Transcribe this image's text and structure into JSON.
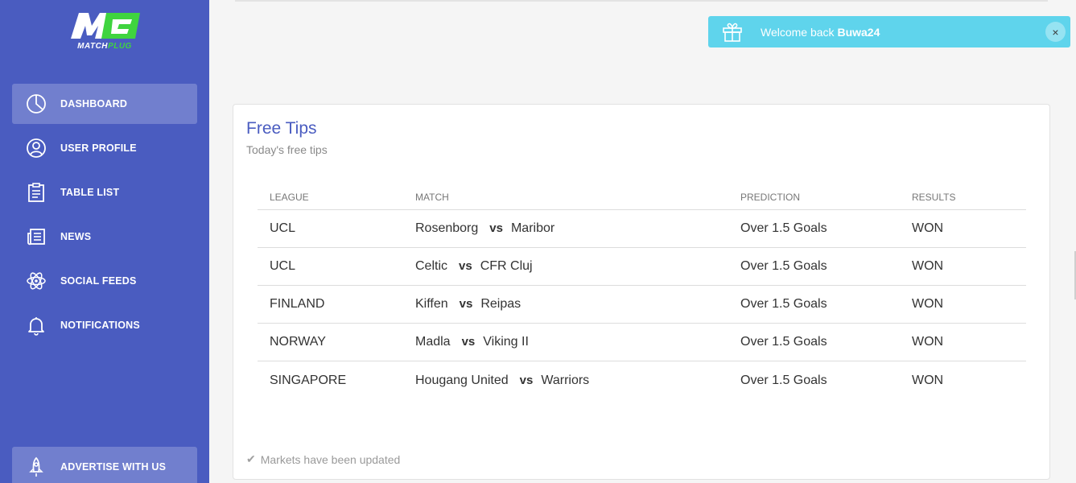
{
  "brand": {
    "logo_top": "M",
    "logo_match": "MATCH",
    "logo_plug": "PLUG",
    "accent": "#4a5cc0",
    "green": "#3fd43f"
  },
  "sidebar": {
    "items": [
      {
        "label": "DASHBOARD",
        "icon": "pie-chart-icon",
        "active": true
      },
      {
        "label": "USER PROFILE",
        "icon": "user-icon"
      },
      {
        "label": "TABLE LIST",
        "icon": "clipboard-icon"
      },
      {
        "label": "NEWS",
        "icon": "newspaper-icon"
      },
      {
        "label": "SOCIAL FEEDS",
        "icon": "atom-icon"
      },
      {
        "label": "NOTIFICATIONS",
        "icon": "bell-icon"
      }
    ],
    "advertise": {
      "label": "ADVERTISE WITH US",
      "icon": "rocket-icon"
    }
  },
  "toast": {
    "prefix": "Welcome back ",
    "user": "Buwa24",
    "icon": "gift-icon",
    "close": "×"
  },
  "card": {
    "title": "Free Tips",
    "subtitle": "Today's free tips",
    "columns": [
      "LEAGUE",
      "MATCH",
      "PREDICTION",
      "RESULTS"
    ],
    "vs": "vs",
    "rows": [
      {
        "league": "UCL",
        "home": "Rosenborg",
        "away": "Maribor",
        "prediction": "Over 1.5 Goals",
        "result": "WON"
      },
      {
        "league": "UCL",
        "home": "Celtic",
        "away": "CFR Cluj",
        "prediction": "Over 1.5 Goals",
        "result": "WON"
      },
      {
        "league": "FINLAND",
        "home": "Kiffen",
        "away": "Reipas",
        "prediction": "Over 1.5 Goals",
        "result": "WON"
      },
      {
        "league": "NORWAY",
        "home": "Madla",
        "away": "Viking II",
        "prediction": "Over 1.5 Goals",
        "result": "WON"
      },
      {
        "league": "SINGAPORE",
        "home": "Hougang United",
        "away": "Warriors",
        "prediction": "Over 1.5 Goals",
        "result": "WON"
      }
    ],
    "footer": "Markets have been updated"
  }
}
